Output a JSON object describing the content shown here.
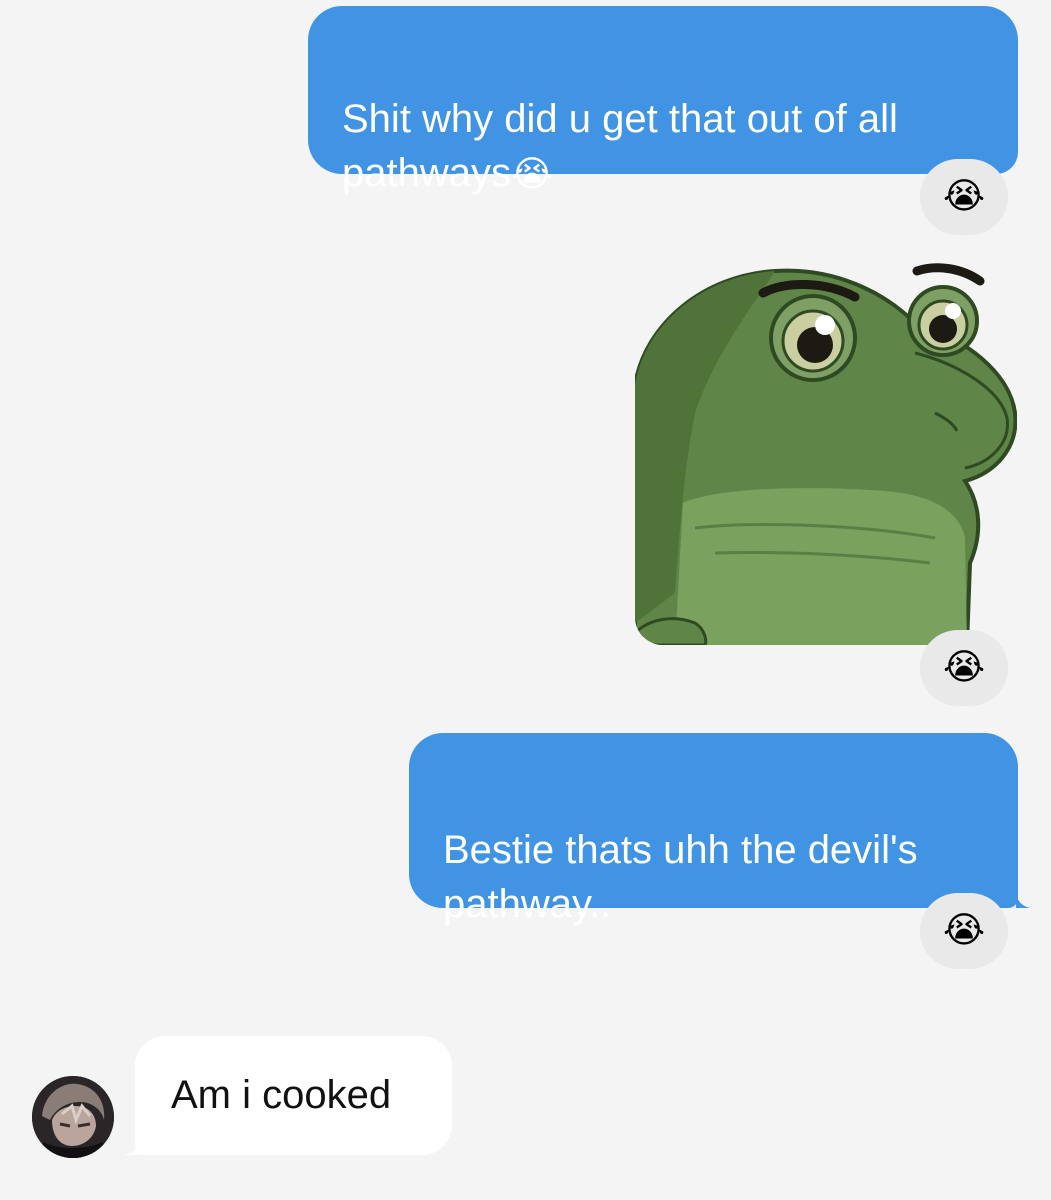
{
  "messages": {
    "m1": {
      "text": "Shit why did u get that out of all\npathways",
      "emoji": "😭",
      "reaction": "😭"
    },
    "sticker": {
      "reaction": "😭"
    },
    "m2": {
      "text": "Bestie thats uhh the devil's\npathway..",
      "reaction": "😭"
    },
    "m3": {
      "text": "Am i cooked"
    }
  },
  "colors": {
    "outgoing_bubble": "#4194e3",
    "incoming_bubble": "#ffffff",
    "background": "#f4f4f4",
    "reaction_pill": "#e9e9e9"
  },
  "icons": {
    "sticker": "sad-frog-sticker",
    "avatar": "contact-avatar"
  }
}
